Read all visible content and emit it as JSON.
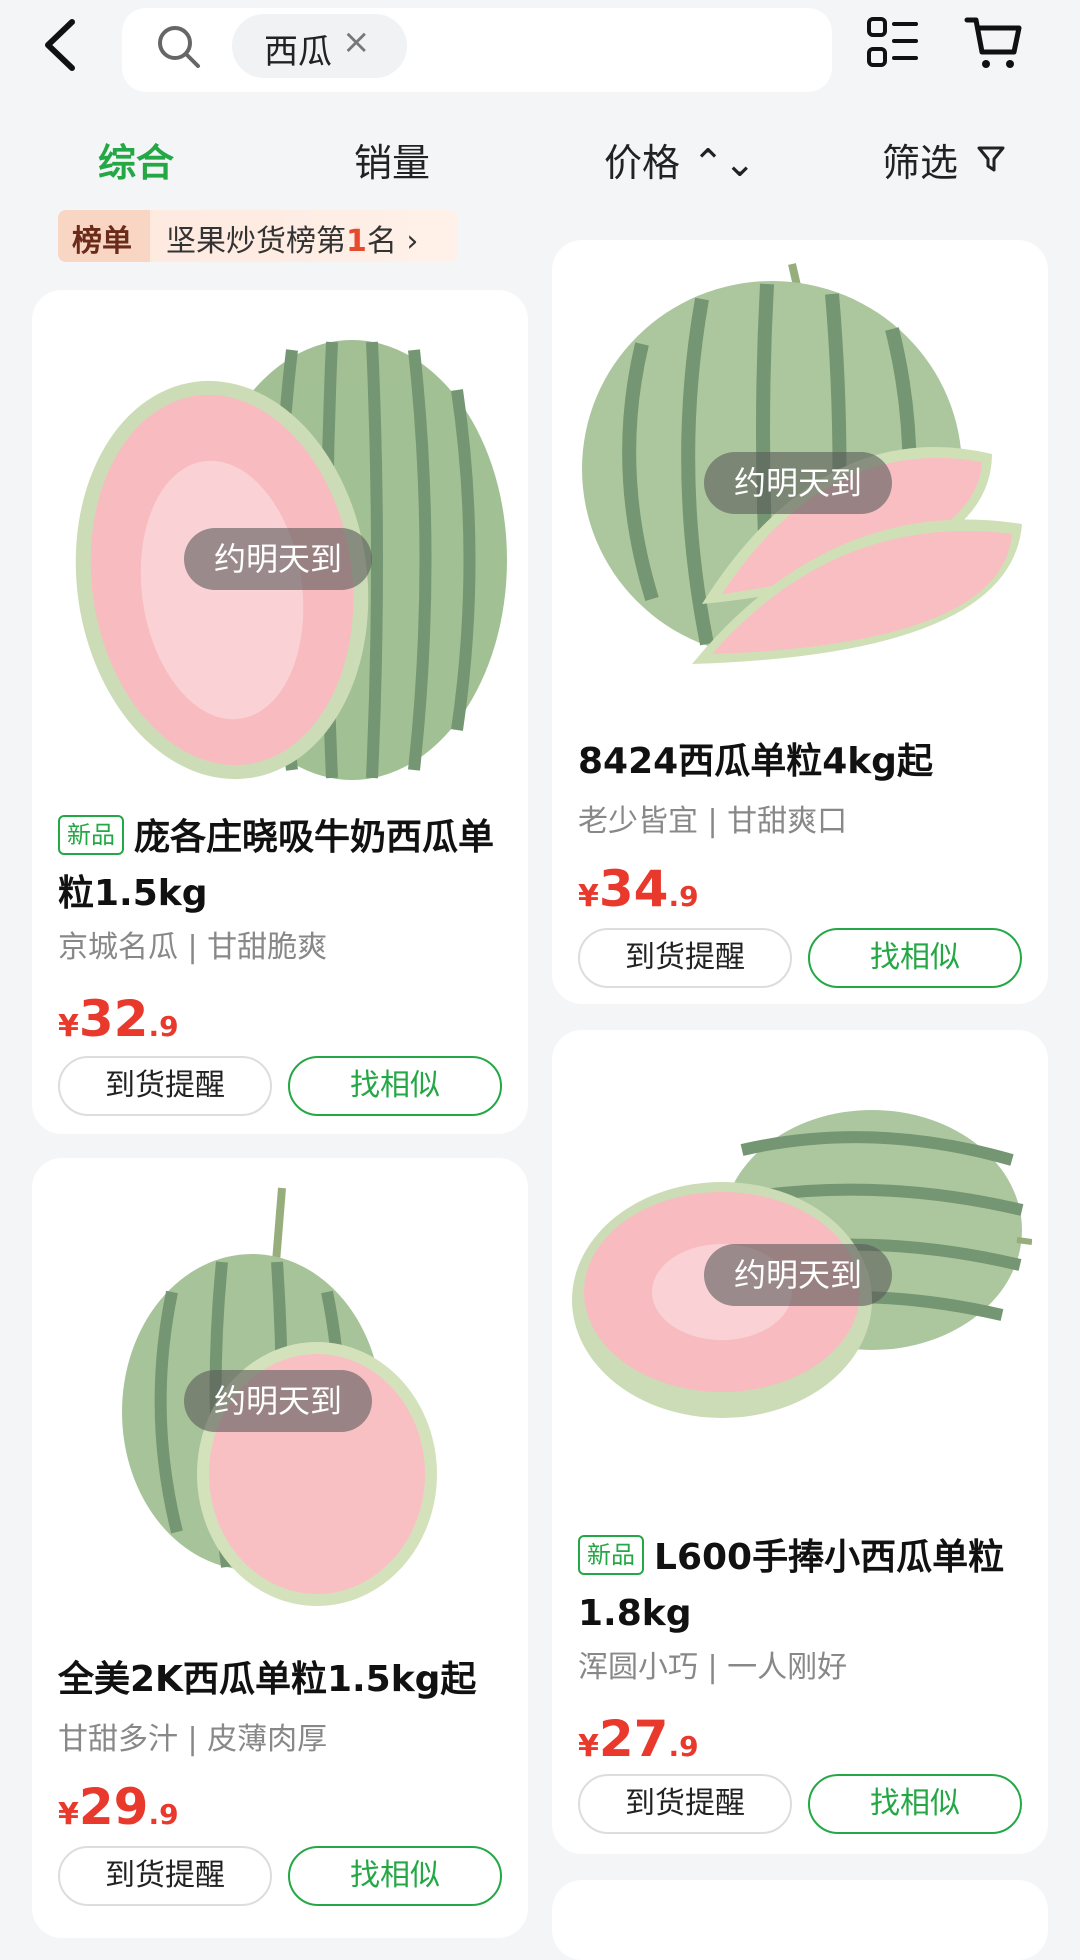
{
  "search": {
    "tag": "西瓜",
    "close": "×"
  },
  "tabs": [
    {
      "label": "综合"
    },
    {
      "label": "销量"
    },
    {
      "label": "价格 ⌃⌄"
    },
    {
      "label": "筛选"
    }
  ],
  "ranking": {
    "tag": "榜单",
    "text_before": "坚果炒货榜第",
    "rank": "1",
    "text_after": "名",
    "chevron": "›"
  },
  "products": [
    {
      "eta": "约明天到",
      "badge": "新品",
      "title": "庞各庄晓吸牛奶西瓜单粒1.5kg",
      "subtitle": "京城名瓜 | 甘甜脆爽",
      "price_symbol": "¥",
      "price_int": "32",
      "price_dec": ".9",
      "remind_label": "到货提醒",
      "similar_label": "找相似"
    },
    {
      "eta": "约明天到",
      "badge": "",
      "title": "8424西瓜单粒4kg起",
      "subtitle": "老少皆宜 | 甘甜爽口",
      "price_symbol": "¥",
      "price_int": "34",
      "price_dec": ".9",
      "remind_label": "到货提醒",
      "similar_label": "找相似"
    },
    {
      "eta": "约明天到",
      "badge": "",
      "title": "全美2K西瓜单粒1.5kg起",
      "subtitle": "甘甜多汁 | 皮薄肉厚",
      "price_symbol": "¥",
      "price_int": "29",
      "price_dec": ".9",
      "remind_label": "到货提醒",
      "similar_label": "找相似"
    },
    {
      "eta": "约明天到",
      "badge": "新品",
      "title": "L600手捧小西瓜单粒1.8kg",
      "subtitle": "浑圆小巧 | 一人刚好",
      "price_symbol": "¥",
      "price_int": "27",
      "price_dec": ".9",
      "remind_label": "到货提醒",
      "similar_label": "找相似"
    }
  ],
  "colors": {
    "accent": "#23a845",
    "price": "#e8392c"
  },
  "icons": [
    "back-icon",
    "search-icon",
    "list-view-icon",
    "cart-icon",
    "sort-chevron-icon",
    "filter-icon"
  ]
}
